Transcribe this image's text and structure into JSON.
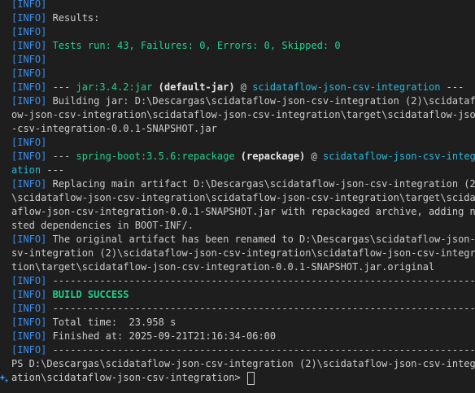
{
  "lines": [
    {
      "info": "[INFO]"
    },
    {
      "info": "[INFO]",
      "text": " Results:"
    },
    {
      "info": "[INFO]"
    },
    {
      "info": "[INFO]",
      "green": " Tests run: 43, Failures: 0, Errors: 0, Skipped: 0"
    },
    {
      "info": "[INFO]"
    },
    {
      "info": "[INFO]"
    },
    {
      "info": "[INFO]",
      "pre": " --- ",
      "plugin": "jar:3.4.2:jar",
      "mid": " ",
      "goal": "(default-jar)",
      "at": " @ ",
      "proj": "scidataflow-json-csv-integration",
      "post": " ---"
    },
    {
      "info": "[INFO]",
      "text": " Building jar: D:\\Descargas\\scidataflow-json-csv-integration (2)\\scidataflo"
    },
    {
      "text": "ow-json-csv-integration\\scidataflow-json-csv-integration\\target\\scidataflow-json"
    },
    {
      "text": "-csv-integration-0.0.1-SNAPSHOT.jar"
    },
    {
      "info": "[INFO]"
    },
    {
      "info": "[INFO]",
      "pre": " --- ",
      "plugin": "spring-boot:3.5.6:repackage",
      "mid": " ",
      "goal": "(repackage)",
      "at": " @ ",
      "proj": "scidataflow-json-csv-integr"
    },
    {
      "proj": "ation",
      "post": " ---"
    },
    {
      "info": "[INFO]",
      "text": " Replacing main artifact D:\\Descargas\\scidataflow-json-csv-integration (2)"
    },
    {
      "text": "\\scidataflow-json-csv-integration\\scidataflow-json-csv-integration\\target\\scidat"
    },
    {
      "text": "aflow-json-csv-integration-0.0.1-SNAPSHOT.jar with repackaged archive, adding ne"
    },
    {
      "text": "sted dependencies in BOOT-INF/."
    },
    {
      "info": "[INFO]",
      "text": " The original artifact has been renamed to D:\\Descargas\\scidataflow-json-c"
    },
    {
      "text": "sv-integration (2)\\scidataflow-json-csv-integration\\scidataflow-json-csv-integra"
    },
    {
      "text": "tion\\target\\scidataflow-json-csv-integration-0.0.1-SNAPSHOT.jar.original"
    },
    {
      "info": "[INFO]",
      "text": " ------------------------------------------------------------------------"
    },
    {
      "info": "[INFO]",
      "bgreen": " BUILD SUCCESS"
    },
    {
      "info": "[INFO]",
      "text": " ------------------------------------------------------------------------"
    },
    {
      "info": "[INFO]",
      "text": " Total time:  23.958 s"
    },
    {
      "info": "[INFO]",
      "text": " Finished at: 2025-09-21T21:16:34-06:00"
    },
    {
      "info": "[INFO]",
      "text": " ------------------------------------------------------------------------"
    },
    {
      "text": "PS D:\\Descargas\\scidataflow-json-csv-integration (2)\\scidataflow-json-csv-integr"
    },
    {
      "text": "ation\\scidataflow-json-csv-integration> ",
      "cursor": true,
      "prompt": true
    }
  ],
  "colors": {
    "background": "#1e1e1e",
    "foreground": "#cccccc",
    "info": "#3b8eea",
    "success": "#23d18b",
    "plugin": "#23d18b",
    "project": "#29b8db"
  }
}
